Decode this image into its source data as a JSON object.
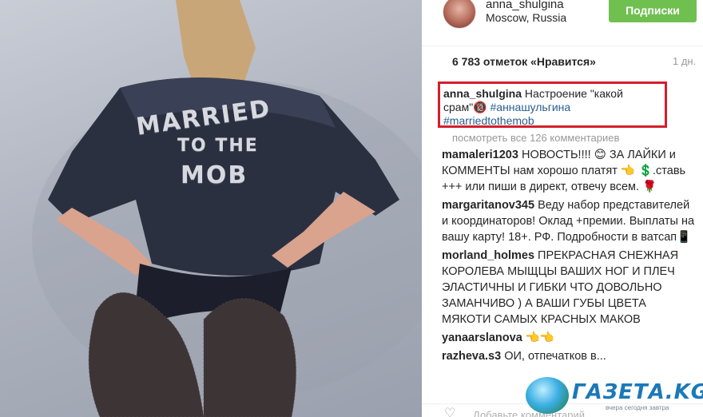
{
  "photo": {
    "jacket_lines": [
      "MARRIED",
      "TO THE",
      "MOB"
    ]
  },
  "post": {
    "username": "anna_shulgina",
    "location": "Moscow, Russia",
    "follow_label": "Подписки",
    "likes": "6 783 отметок «Нравится»",
    "time_ago": "1 дн.",
    "caption_user": "anna_shulgina",
    "caption_text": " Настроение \"какой срам\"🔞 ",
    "caption_tag1": "#аннашульгина",
    "caption_tag2": "#marriedtothemob",
    "view_all": "посмотреть все 126 комментариев",
    "add_comment_placeholder": "Добавьте комментарий..."
  },
  "comments": [
    {
      "user": "mamaleri1203",
      "text": " НОВОСТЬ!!!! 😊 ЗА ЛАЙКИ и КОММЕНТЫ нам хорошо платят 👈 💲.ставь +++ или пиши в директ, отвечу всем. 🌹"
    },
    {
      "user": "margaritanov345",
      "text": " Веду набор представителей и координаторов! Оклад +премии. Выплаты на вашу карту! 18+. РФ. Подробности в ватсап📱"
    },
    {
      "user": "morland_holmes",
      "text": " ПРЕКРАСНАЯ СНЕЖНАЯ КОРОЛЕВА МЫЩЦЫ ВАШИХ НОГ И ПЛЕЧ ЭЛАСТИЧНЫ И ГИБКИ ЧТО ДОВОЛЬНО ЗАМАНЧИВО ) А ВАШИ ГУБЫ ЦВЕТА МЯКОТИ САМЫХ КРАСНЫХ МАКОВ"
    },
    {
      "user": "yanaarslanova",
      "text": " 👈👈"
    },
    {
      "user": "razheva.s3",
      "text": " ОИ, отпечатков в..."
    }
  ],
  "watermark": {
    "brand": "ГАЗЕТА.KG",
    "tagline": "вчера сегодня завтра"
  },
  "colors": {
    "follow_button": "#70c050",
    "highlight_border": "#d41f2b",
    "hashtag": "#2a5d8f"
  }
}
